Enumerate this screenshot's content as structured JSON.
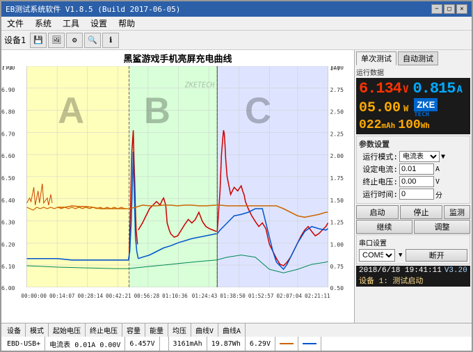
{
  "titlebar": {
    "title": "EB测试系统软件 V1.8.5 (Build 2017-06-05)",
    "min": "−",
    "max": "□",
    "close": "✕"
  },
  "menubar": {
    "items": [
      "文件",
      "系统",
      "工具",
      "设置",
      "帮助"
    ]
  },
  "toolbar": {
    "device_label": "设备1",
    "icons": [
      "💾",
      "🖼",
      "⚙",
      "🔍",
      "ℹ"
    ]
  },
  "chart": {
    "title": "黑鲨游戏手机亮屏充电曲线",
    "y_left_label": "[V]",
    "y_right_label": "[A]",
    "y_left_ticks": [
      "7.00",
      "6.90",
      "6.80",
      "6.70",
      "6.60",
      "6.50",
      "6.40",
      "6.30",
      "6.20",
      "6.10",
      "6.00"
    ],
    "y_right_ticks": [
      "3.00",
      "2.75",
      "2.50",
      "2.25",
      "2.00",
      "1.75",
      "1.50",
      "1.25",
      "1.00",
      "0.75",
      "0.50"
    ],
    "x_ticks": [
      "00:00:00",
      "00:14:07",
      "00:28:14",
      "00:42:21",
      "00:56:28",
      "01:10:36",
      "01:24:43",
      "01:38:50",
      "01:52:57",
      "02:07:04",
      "02:21:11"
    ],
    "labels": [
      "A",
      "B",
      "C"
    ],
    "region_colors": [
      "#ffffa0",
      "#c8ffc8",
      "#d0d8ff"
    ]
  },
  "panel": {
    "tabs": [
      "单次测试",
      "自动测试"
    ],
    "section_data": {
      "voltage": "6.134",
      "voltage_unit": "V",
      "current": "0.815",
      "current_unit": "A",
      "power": "05.00",
      "power_unit": "W",
      "mah": "022",
      "wh": "100"
    },
    "params": {
      "title": "参数设置",
      "mode_label": "运行模式:",
      "mode_value": "电流表",
      "current_label": "设定电流:",
      "current_value": "0.01",
      "current_unit": "A",
      "voltage_label": "终止电压:",
      "voltage_value": "0.00",
      "voltage_unit": "V",
      "time_label": "运行时间:",
      "time_value": "0",
      "time_unit": "分"
    },
    "buttons": {
      "start": "启动",
      "stop": "停止",
      "monitor": "监测",
      "continue": "继续",
      "adjust": "调整"
    },
    "com": {
      "title": "串口设置",
      "port": "COM5",
      "disconnect": "断开"
    },
    "status": {
      "datetime": "2018/6/18 19:41:11",
      "version": "V3.20",
      "device": "设备 1: 测试启动"
    }
  },
  "bottom_bar": {
    "device": "EBD-USB+",
    "mode": "电流表 0.01A 0.00V",
    "start_voltage": "6.457V",
    "end_voltage": "",
    "capacity": "3161mAh",
    "energy": "19.87Wh",
    "voltage2": "6.29V",
    "curve_v": "",
    "curve_a": "",
    "col_labels": [
      "设备",
      "模式",
      "起始电压",
      "终止电压",
      "容量",
      "能量",
      "均压",
      "曲线V",
      "曲线A"
    ]
  }
}
